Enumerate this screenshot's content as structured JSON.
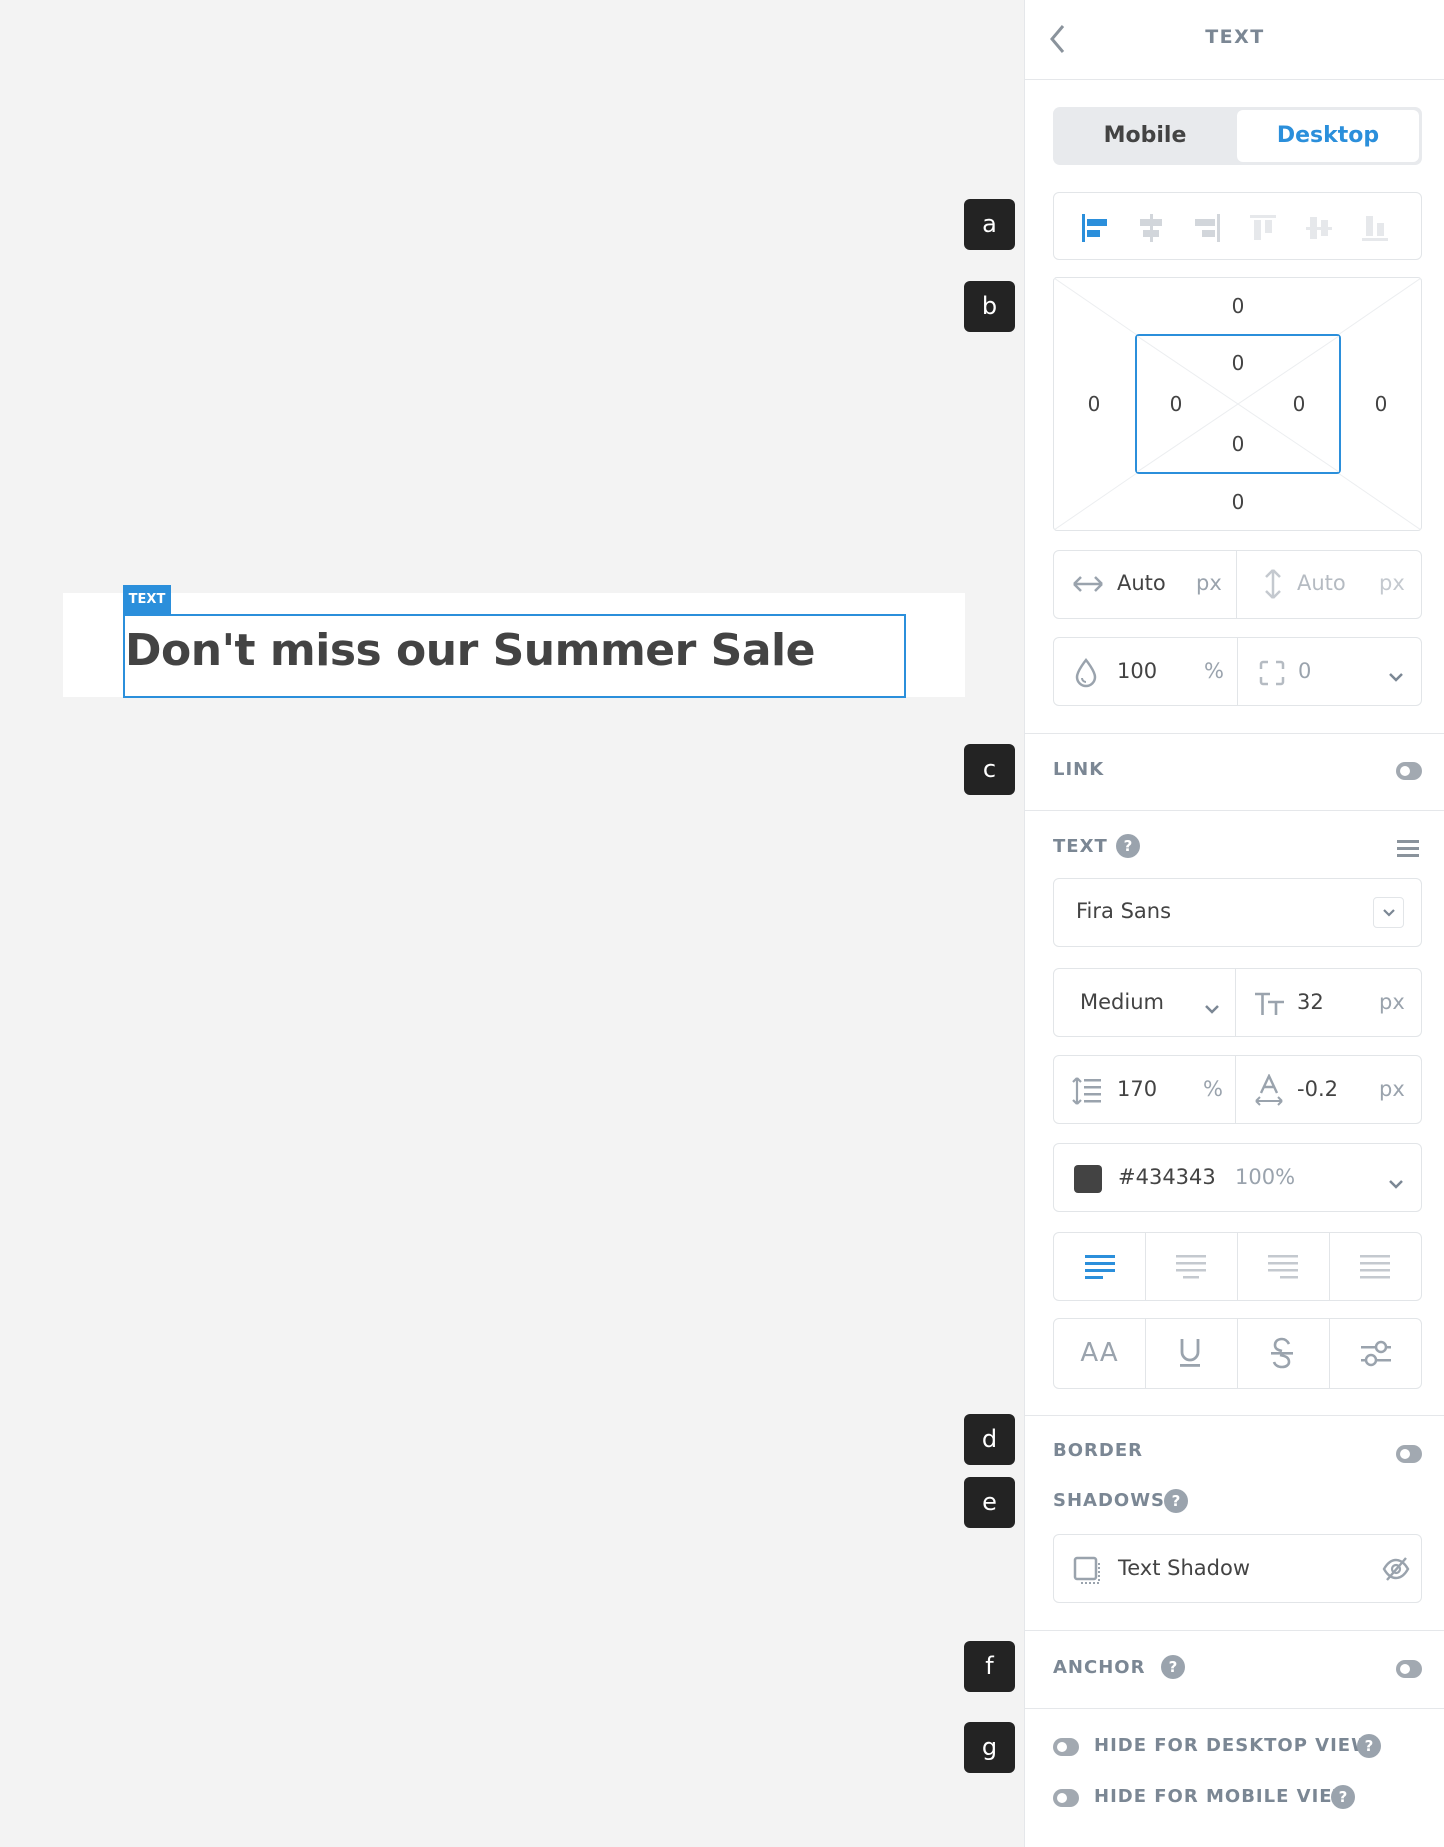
{
  "canvas": {
    "element_tag": "TEXT",
    "headline": "Don't miss our Summer Sale"
  },
  "markers": [
    "a",
    "b",
    "c",
    "d",
    "e",
    "f",
    "g"
  ],
  "panel": {
    "title": "TEXT",
    "device_tabs": {
      "mobile": "Mobile",
      "desktop": "Desktop",
      "active": "Desktop"
    },
    "spacing": {
      "margin": {
        "top": "0",
        "right": "0",
        "bottom": "0",
        "left": "0"
      },
      "padding": {
        "top": "0",
        "right": "0",
        "bottom": "0",
        "left": "0"
      }
    },
    "size": {
      "width": "Auto",
      "width_unit": "px",
      "height": "Auto",
      "height_unit": "px"
    },
    "opacity": {
      "value": "100",
      "unit": "%"
    },
    "radius": {
      "value": "0"
    },
    "link": {
      "label": "LINK"
    },
    "text": {
      "label": "TEXT",
      "help": "?",
      "font_family": "Fira Sans",
      "font_weight": "Medium",
      "font_size": "32",
      "font_size_unit": "px",
      "line_height": "170",
      "line_height_unit": "%",
      "letter_spacing": "-0.2",
      "letter_spacing_unit": "px",
      "color_hex": "#434343",
      "color_opacity": "100%",
      "style_uppercase": "AA"
    },
    "border": {
      "label": "BORDER"
    },
    "shadows": {
      "label": "SHADOWS",
      "help": "?",
      "item": "Text Shadow"
    },
    "anchor": {
      "label": "ANCHOR",
      "help": "?"
    },
    "hide_desktop": {
      "label": "HIDE FOR DESKTOP VIEW",
      "help": "?"
    },
    "hide_mobile": {
      "label": "HIDE FOR MOBILE VIEW",
      "help": "?"
    }
  },
  "colors": {
    "accent": "#2b8fdb",
    "text_color": "#434343"
  }
}
